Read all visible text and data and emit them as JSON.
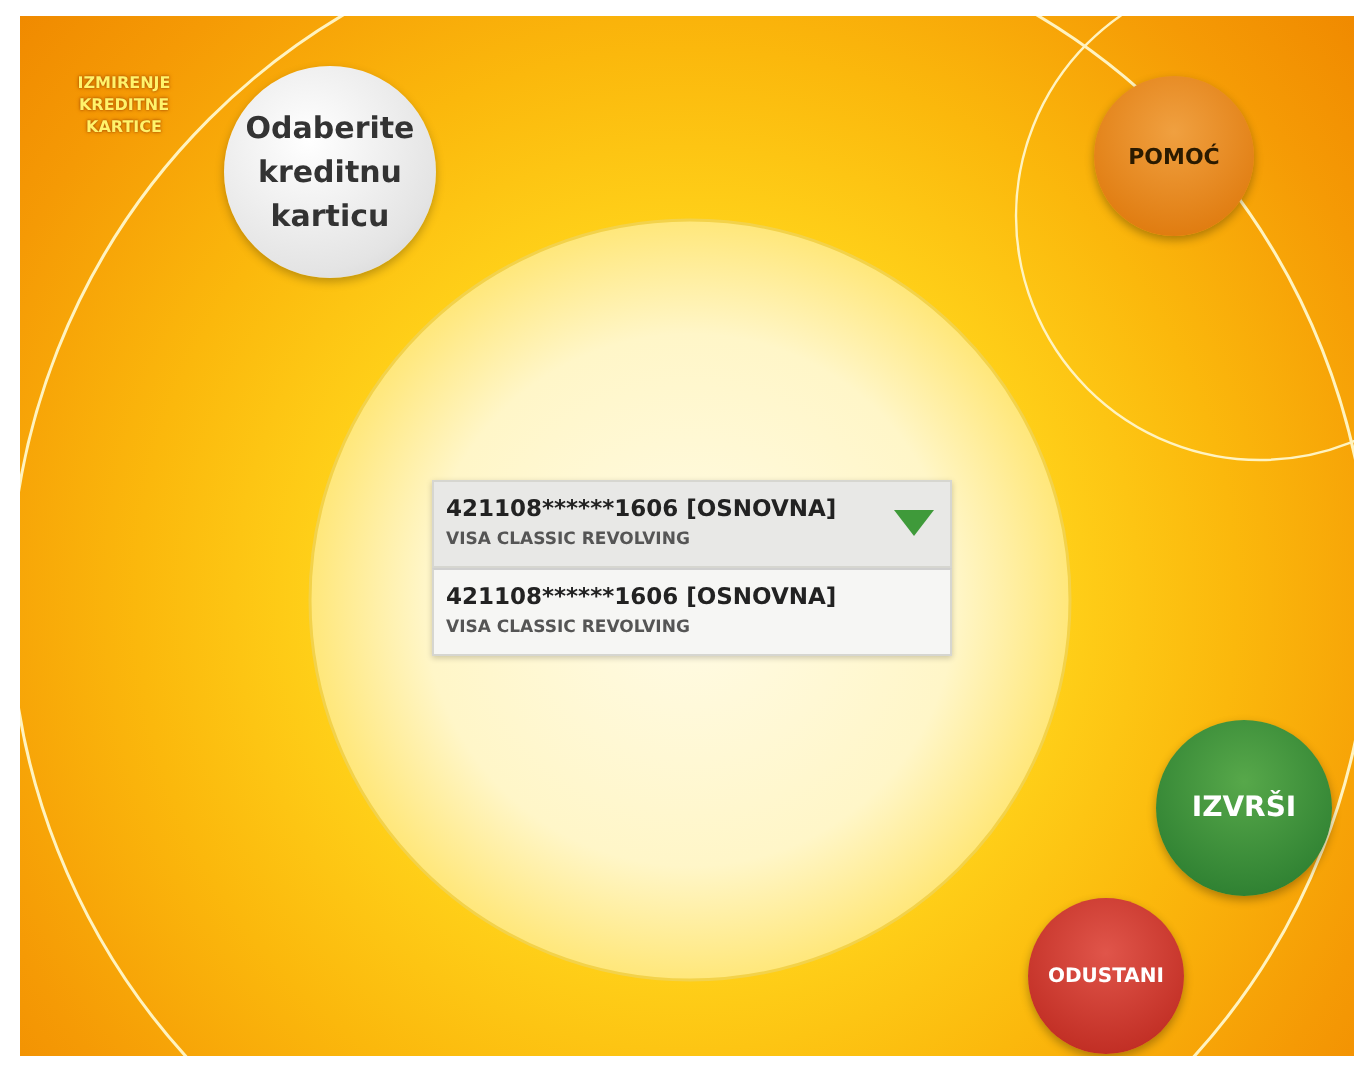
{
  "section_title": "IZMIRENJE KREDITNE KARTICE",
  "prompt": "Odaberite kreditnu karticu",
  "help_button": "POMOĆ",
  "card_dropdown": {
    "expanded": true,
    "number": "421108******1606 [OSNOVNA]",
    "product": "VISA CLASSIC REVOLVING",
    "options": [
      {
        "number": "421108******1606 [OSNOVNA]",
        "product": "VISA CLASSIC REVOLVING",
        "selected": false
      }
    ]
  },
  "confirm_button": "IZVRŠI",
  "cancel_button": "ODUSTANI"
}
